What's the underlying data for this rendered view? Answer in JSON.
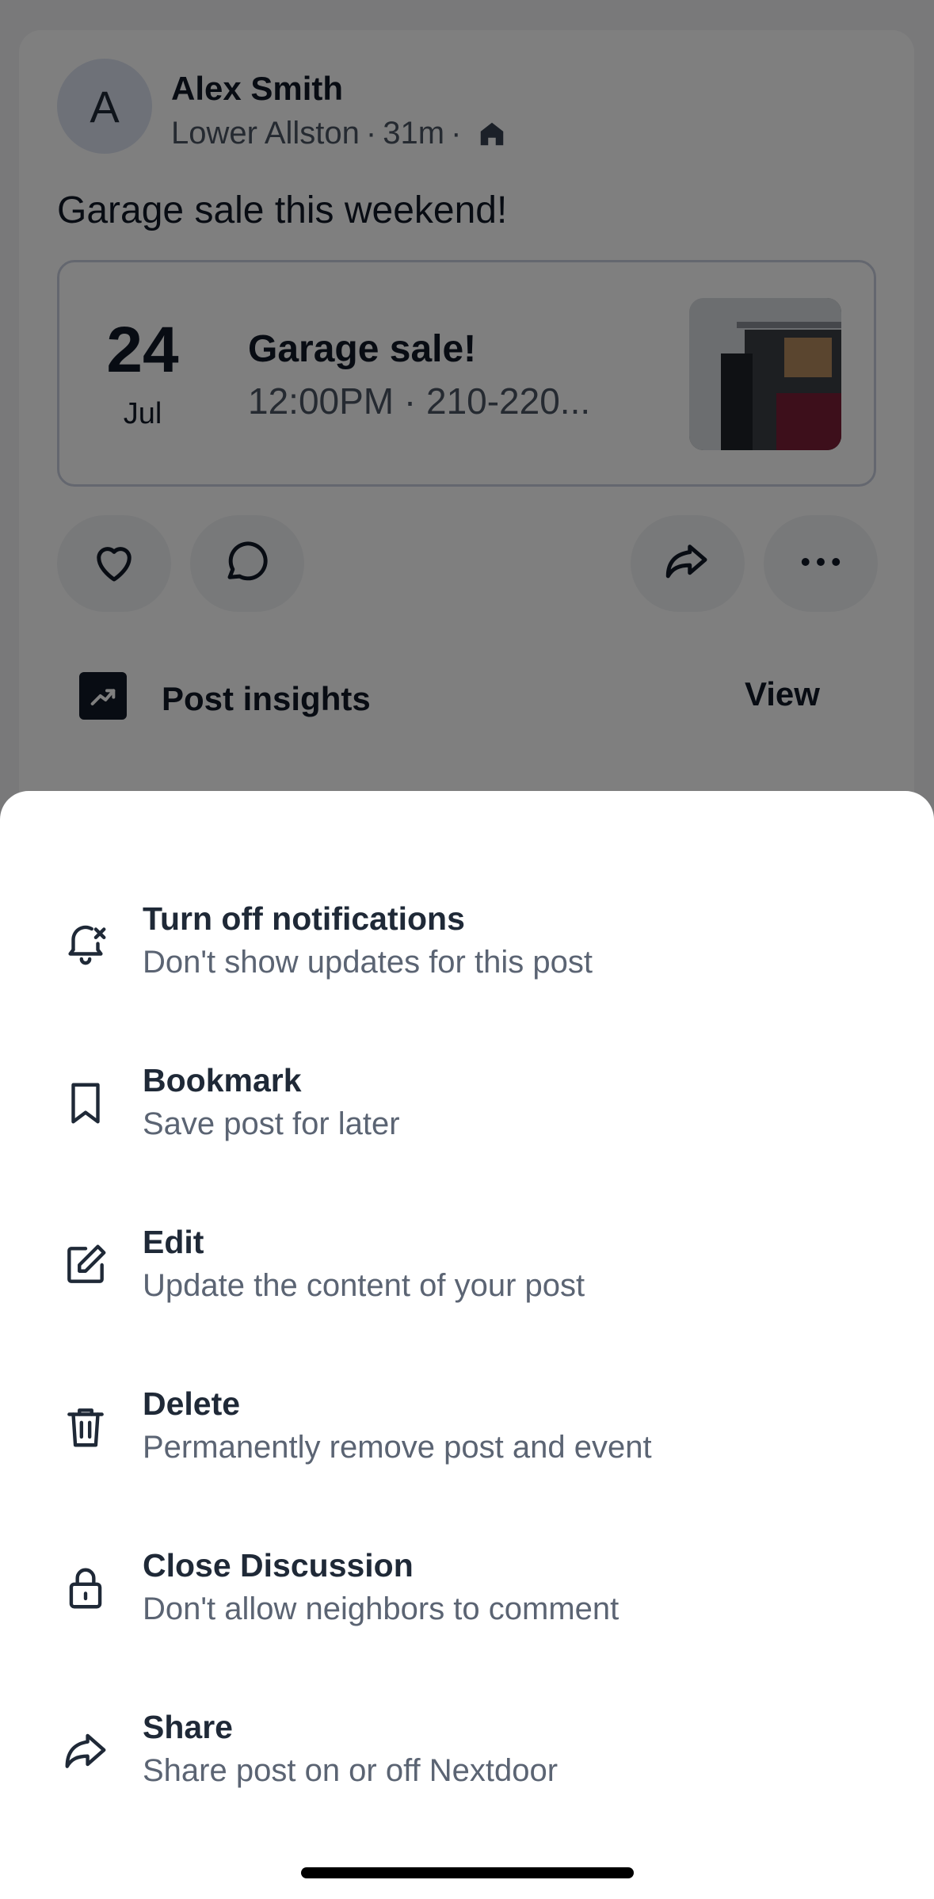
{
  "post": {
    "avatar_initial": "A",
    "author_name": "Alex Smith",
    "location": "Lower Allston",
    "separator": "·",
    "time_ago": "31m",
    "text": "Garage sale this weekend!",
    "event": {
      "day": "24",
      "month": "Jul",
      "title": "Garage sale!",
      "details": "12:00PM · 210-220..."
    },
    "insights": {
      "label": "Post insights",
      "view_label": "View"
    }
  },
  "sheet": {
    "items": [
      {
        "title": "Turn off notifications",
        "subtitle": "Don't show updates for this post",
        "icon": "bell-off-icon"
      },
      {
        "title": "Bookmark",
        "subtitle": "Save post for later",
        "icon": "bookmark-icon"
      },
      {
        "title": "Edit",
        "subtitle": "Update the content of your post",
        "icon": "edit-icon"
      },
      {
        "title": "Delete",
        "subtitle": "Permanently remove post and event",
        "icon": "trash-icon"
      },
      {
        "title": "Close Discussion",
        "subtitle": "Don't allow neighbors to comment",
        "icon": "lock-icon"
      },
      {
        "title": "Share",
        "subtitle": "Share post on or off Nextdoor",
        "icon": "share-icon"
      }
    ]
  },
  "colors": {
    "text_primary": "#1f2937",
    "text_secondary": "#5b6473",
    "overlay": "rgba(0,0,0,0.5)"
  }
}
